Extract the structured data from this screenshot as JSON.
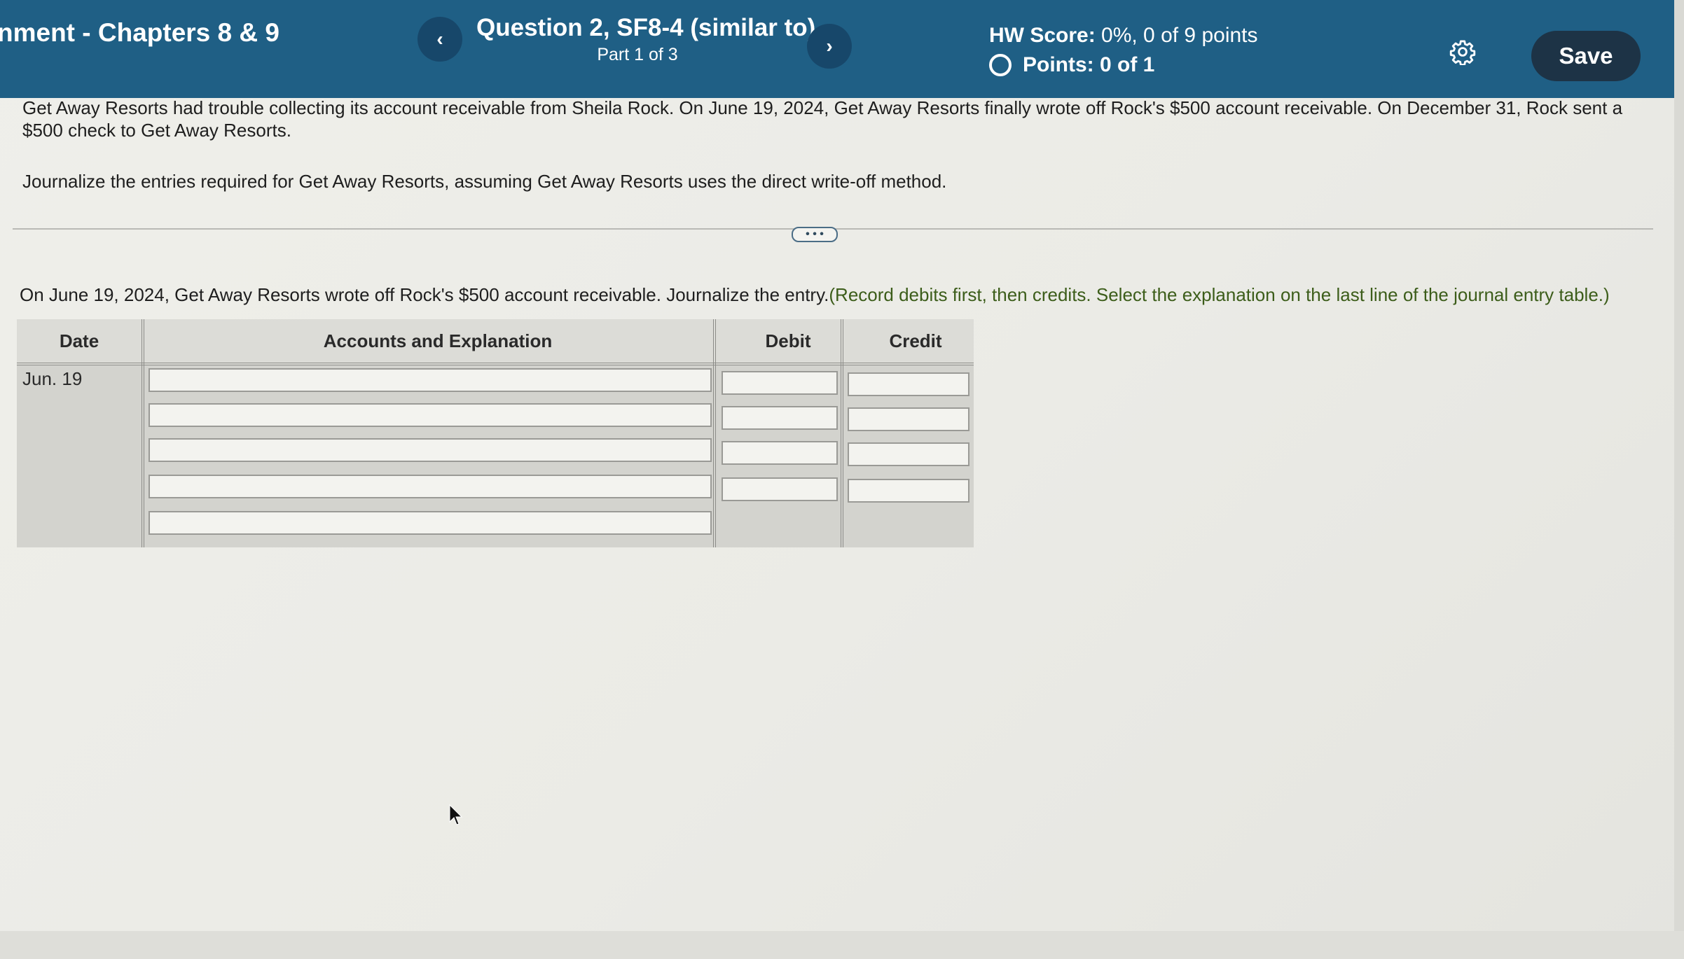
{
  "header": {
    "assignment_title": "nment - Chapters 8 & 9",
    "prev_icon": "chevron-left-icon",
    "prev_glyph": "‹",
    "question_title": "Question 2, SF8-4 (similar to)",
    "question_part": "Part 1 of 3",
    "next_icon": "chevron-right-icon",
    "next_glyph": "›",
    "hw_score_label": "HW Score:",
    "hw_score_value": "0%, 0 of 9 points",
    "points_icon": "circle-outline-icon",
    "points_text": "Points: 0 of 1",
    "settings_icon": "gear-icon",
    "save_label": "Save",
    "bar_color": "#1f5f85"
  },
  "problem": {
    "text": "Get Away Resorts had trouble collecting its account receivable from Sheila Rock. On June 19, 2024, Get Away Resorts finally wrote off Rock's $500 account receivable. On December 31, Rock sent a $500 check to Get Away Resorts.",
    "instruction": "Journalize the entries required for Get Away Resorts, assuming Get Away Resorts uses the direct write-off method."
  },
  "expand_handle": "• • •",
  "part": {
    "prompt": "On June 19, 2024, Get Away Resorts wrote off Rock's $500 account receivable. Journalize the entry.",
    "hint": "(Record debits first, then credits. Select the explanation on the last line of the journal entry table.)",
    "hint_color": "#3c5d1a"
  },
  "journal": {
    "headers": {
      "date": "Date",
      "accounts": "Accounts and Explanation",
      "debit": "Debit",
      "credit": "Credit"
    },
    "date": "Jun. 19",
    "rows": [
      {
        "account": "",
        "debit": "",
        "credit": ""
      },
      {
        "account": "",
        "debit": "",
        "credit": ""
      },
      {
        "account": "",
        "debit": "",
        "credit": ""
      },
      {
        "account": "",
        "debit": "",
        "credit": ""
      },
      {
        "account": ""
      }
    ]
  }
}
